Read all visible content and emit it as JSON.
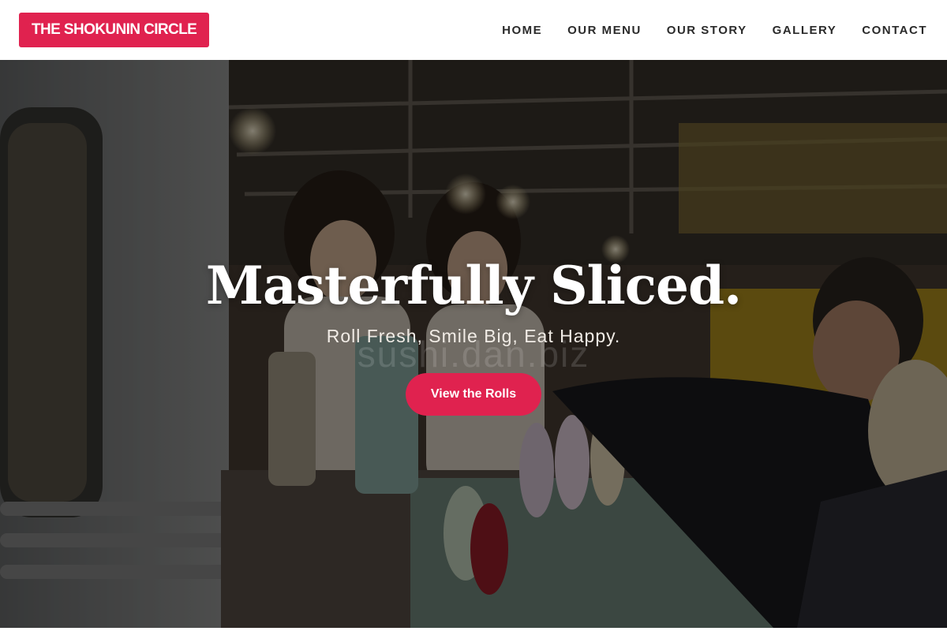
{
  "header": {
    "logo_text": "THE SHOKUNIN CIRCLE",
    "nav": [
      {
        "label": "HOME"
      },
      {
        "label": "OUR MENU"
      },
      {
        "label": "OUR STORY"
      },
      {
        "label": "GALLERY"
      },
      {
        "label": "CONTACT"
      }
    ]
  },
  "hero": {
    "title": "Masterfully Sliced.",
    "tagline": "Roll Fresh, Smile Big, Eat Happy.",
    "cta_label": "View the Rolls",
    "watermark": "sushi.dan.biz",
    "image_icon": "food-stall-photo"
  },
  "colors": {
    "accent": "#e0224f",
    "header_bg": "#ffffff",
    "nav_text": "#2a2a2a",
    "hero_text": "#ffffff"
  }
}
